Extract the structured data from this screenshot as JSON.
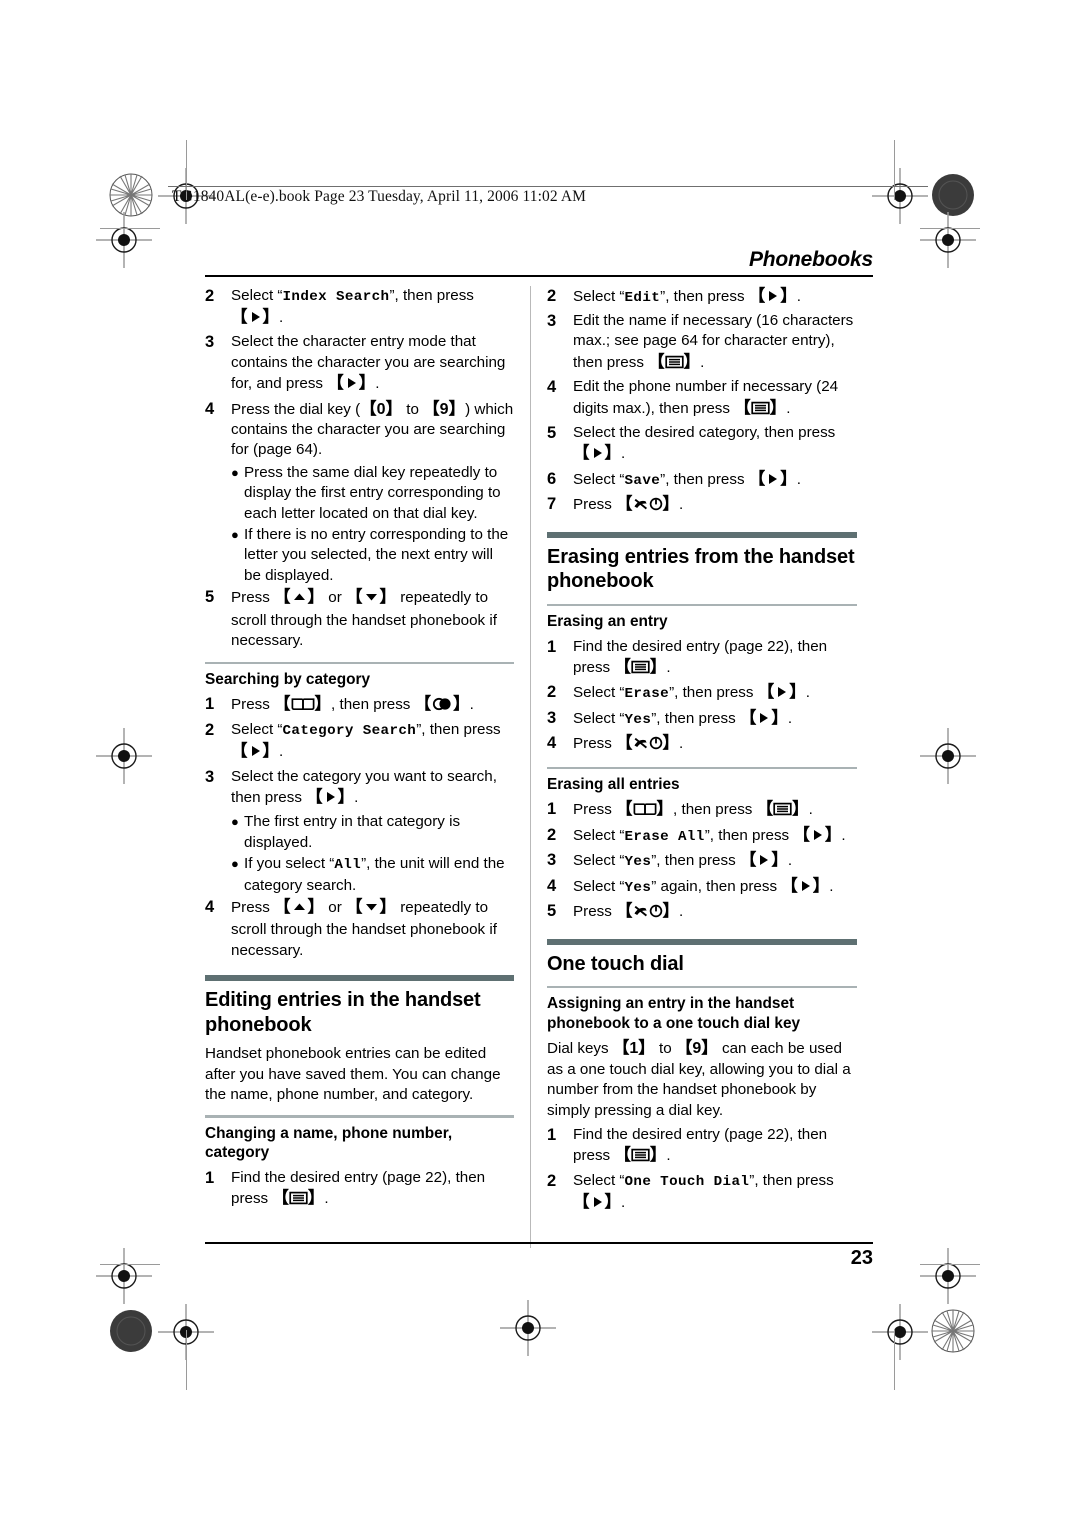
{
  "slug": "TG1840AL(e-e).book  Page 23  Tuesday, April 11, 2006  11:02 AM",
  "running_head": "Phonebooks",
  "page_number": "23",
  "colors": {
    "section_bar": "#5e7072",
    "subsection_rule": "#a9b2b4",
    "head_rule": "#000000"
  },
  "left_column": {
    "index_search_steps": [
      {
        "num": "2",
        "parts": [
          {
            "t": "text",
            "v": "Select “"
          },
          {
            "t": "mono",
            "v": "Index Search"
          },
          {
            "t": "text",
            "v": "”, then press "
          },
          {
            "t": "key",
            "icon": "right-arrow-key"
          },
          {
            "t": "text",
            "v": "."
          }
        ]
      },
      {
        "num": "3",
        "parts": [
          {
            "t": "text",
            "v": "Select the character entry mode that contains the character you are searching for, and press "
          },
          {
            "t": "key",
            "icon": "right-arrow-key"
          },
          {
            "t": "text",
            "v": "."
          }
        ]
      },
      {
        "num": "4",
        "parts": [
          {
            "t": "text",
            "v": "Press the dial key ("
          },
          {
            "t": "key",
            "icon": "digit-key",
            "label": "0"
          },
          {
            "t": "text",
            "v": " to "
          },
          {
            "t": "key",
            "icon": "digit-key",
            "label": "9"
          },
          {
            "t": "text",
            "v": ") which contains the character you are searching for (page 64)."
          }
        ]
      }
    ],
    "index_search_bullets": [
      "Press the same dial key repeatedly to display the first entry corresponding to each letter located on that dial key.",
      "If there is no entry corresponding to the letter you selected, the next entry will be displayed."
    ],
    "index_search_step5": {
      "num": "5",
      "parts": [
        {
          "t": "text",
          "v": "Press "
        },
        {
          "t": "key",
          "icon": "up-arrow-key"
        },
        {
          "t": "text",
          "v": " or "
        },
        {
          "t": "key",
          "icon": "down-arrow-key"
        },
        {
          "t": "text",
          "v": " repeatedly to scroll through the handset phonebook if necessary."
        }
      ]
    },
    "searching_by_category": {
      "heading": "Searching by category",
      "steps": [
        {
          "num": "1",
          "parts": [
            {
              "t": "text",
              "v": "Press "
            },
            {
              "t": "key",
              "icon": "phonebook-key"
            },
            {
              "t": "text",
              "v": ", then press "
            },
            {
              "t": "key",
              "icon": "talk-key"
            },
            {
              "t": "text",
              "v": "."
            }
          ]
        },
        {
          "num": "2",
          "parts": [
            {
              "t": "text",
              "v": "Select “"
            },
            {
              "t": "mono",
              "v": "Category Search"
            },
            {
              "t": "text",
              "v": "”, then press "
            },
            {
              "t": "key",
              "icon": "right-arrow-key"
            },
            {
              "t": "text",
              "v": "."
            }
          ]
        },
        {
          "num": "3",
          "parts": [
            {
              "t": "text",
              "v": "Select the category you want to search, then press "
            },
            {
              "t": "key",
              "icon": "right-arrow-key"
            },
            {
              "t": "text",
              "v": "."
            }
          ]
        }
      ],
      "bullets": [
        [
          {
            "t": "text",
            "v": "The first entry in that category is displayed."
          }
        ],
        [
          {
            "t": "text",
            "v": "If you select “"
          },
          {
            "t": "mono",
            "v": "All"
          },
          {
            "t": "text",
            "v": "”, the unit will end the category search."
          }
        ]
      ],
      "step4": {
        "num": "4",
        "parts": [
          {
            "t": "text",
            "v": "Press "
          },
          {
            "t": "key",
            "icon": "up-arrow-key"
          },
          {
            "t": "text",
            "v": " or "
          },
          {
            "t": "key",
            "icon": "down-arrow-key"
          },
          {
            "t": "text",
            "v": " repeatedly to scroll through the handset phonebook if necessary."
          }
        ]
      }
    },
    "editing_section": {
      "title": "Editing entries in the handset phonebook",
      "intro": "Handset phonebook entries can be edited after you have saved them. You can change the name, phone number, and category.",
      "sub_heading": "Changing a name, phone number, category",
      "step1": {
        "num": "1",
        "parts": [
          {
            "t": "text",
            "v": "Find the desired entry (page 22), then press "
          },
          {
            "t": "key",
            "icon": "menu-ok-key"
          },
          {
            "t": "text",
            "v": "."
          }
        ]
      }
    }
  },
  "right_column": {
    "editing_steps": [
      {
        "num": "2",
        "parts": [
          {
            "t": "text",
            "v": "Select “"
          },
          {
            "t": "mono",
            "v": "Edit"
          },
          {
            "t": "text",
            "v": "”, then press "
          },
          {
            "t": "key",
            "icon": "right-arrow-key"
          },
          {
            "t": "text",
            "v": "."
          }
        ]
      },
      {
        "num": "3",
        "parts": [
          {
            "t": "text",
            "v": "Edit the name if necessary (16 characters max.; see page 64 for character entry), then press "
          },
          {
            "t": "key",
            "icon": "menu-ok-key"
          },
          {
            "t": "text",
            "v": "."
          }
        ]
      },
      {
        "num": "4",
        "parts": [
          {
            "t": "text",
            "v": "Edit the phone number if necessary (24 digits max.), then press "
          },
          {
            "t": "key",
            "icon": "menu-ok-key"
          },
          {
            "t": "text",
            "v": "."
          }
        ]
      },
      {
        "num": "5",
        "parts": [
          {
            "t": "text",
            "v": "Select the desired category, then press "
          },
          {
            "t": "key",
            "icon": "right-arrow-key"
          },
          {
            "t": "text",
            "v": "."
          }
        ]
      },
      {
        "num": "6",
        "parts": [
          {
            "t": "text",
            "v": "Select “"
          },
          {
            "t": "mono",
            "v": "Save"
          },
          {
            "t": "text",
            "v": "”, then press "
          },
          {
            "t": "key",
            "icon": "right-arrow-key"
          },
          {
            "t": "text",
            "v": "."
          }
        ]
      },
      {
        "num": "7",
        "parts": [
          {
            "t": "text",
            "v": "Press "
          },
          {
            "t": "key",
            "icon": "off-power-key"
          },
          {
            "t": "text",
            "v": "."
          }
        ]
      }
    ],
    "erasing_section": {
      "title": "Erasing entries from the handset phonebook",
      "erasing_an_entry": {
        "heading": "Erasing an entry",
        "steps": [
          {
            "num": "1",
            "parts": [
              {
                "t": "text",
                "v": "Find the desired entry (page 22), then press "
              },
              {
                "t": "key",
                "icon": "menu-ok-key"
              },
              {
                "t": "text",
                "v": "."
              }
            ]
          },
          {
            "num": "2",
            "parts": [
              {
                "t": "text",
                "v": "Select “"
              },
              {
                "t": "mono",
                "v": "Erase"
              },
              {
                "t": "text",
                "v": "”, then press "
              },
              {
                "t": "key",
                "icon": "right-arrow-key"
              },
              {
                "t": "text",
                "v": "."
              }
            ]
          },
          {
            "num": "3",
            "parts": [
              {
                "t": "text",
                "v": "Select “"
              },
              {
                "t": "mono",
                "v": "Yes"
              },
              {
                "t": "text",
                "v": "”, then press "
              },
              {
                "t": "key",
                "icon": "right-arrow-key"
              },
              {
                "t": "text",
                "v": "."
              }
            ]
          },
          {
            "num": "4",
            "parts": [
              {
                "t": "text",
                "v": "Press "
              },
              {
                "t": "key",
                "icon": "off-power-key"
              },
              {
                "t": "text",
                "v": "."
              }
            ]
          }
        ]
      },
      "erasing_all_entries": {
        "heading": "Erasing all entries",
        "steps": [
          {
            "num": "1",
            "parts": [
              {
                "t": "text",
                "v": "Press "
              },
              {
                "t": "key",
                "icon": "phonebook-key"
              },
              {
                "t": "text",
                "v": ", then press "
              },
              {
                "t": "key",
                "icon": "menu-ok-key"
              },
              {
                "t": "text",
                "v": "."
              }
            ]
          },
          {
            "num": "2",
            "parts": [
              {
                "t": "text",
                "v": "Select “"
              },
              {
                "t": "mono",
                "v": "Erase All"
              },
              {
                "t": "text",
                "v": "”, then press "
              },
              {
                "t": "key",
                "icon": "right-arrow-key"
              },
              {
                "t": "text",
                "v": "."
              }
            ]
          },
          {
            "num": "3",
            "parts": [
              {
                "t": "text",
                "v": "Select “"
              },
              {
                "t": "mono",
                "v": "Yes"
              },
              {
                "t": "text",
                "v": "”, then press "
              },
              {
                "t": "key",
                "icon": "right-arrow-key"
              },
              {
                "t": "text",
                "v": "."
              }
            ]
          },
          {
            "num": "4",
            "parts": [
              {
                "t": "text",
                "v": "Select “"
              },
              {
                "t": "mono",
                "v": "Yes"
              },
              {
                "t": "text",
                "v": "” again, then press "
              },
              {
                "t": "key",
                "icon": "right-arrow-key"
              },
              {
                "t": "text",
                "v": "."
              }
            ]
          },
          {
            "num": "5",
            "parts": [
              {
                "t": "text",
                "v": "Press "
              },
              {
                "t": "key",
                "icon": "off-power-key"
              },
              {
                "t": "text",
                "v": "."
              }
            ]
          }
        ]
      }
    },
    "one_touch_dial": {
      "title": "One touch dial",
      "sub_heading": "Assigning an entry in the handset phonebook to a one touch dial key",
      "intro_parts": [
        {
          "t": "text",
          "v": "Dial keys "
        },
        {
          "t": "key",
          "icon": "digit-key",
          "label": "1"
        },
        {
          "t": "text",
          "v": " to "
        },
        {
          "t": "key",
          "icon": "digit-key",
          "label": "9"
        },
        {
          "t": "text",
          "v": " can each be used as a one touch dial key, allowing you to dial a number from the handset phonebook by simply pressing a dial key."
        }
      ],
      "steps": [
        {
          "num": "1",
          "parts": [
            {
              "t": "text",
              "v": "Find the desired entry (page 22), then press "
            },
            {
              "t": "key",
              "icon": "menu-ok-key"
            },
            {
              "t": "text",
              "v": "."
            }
          ]
        },
        {
          "num": "2",
          "parts": [
            {
              "t": "text",
              "v": "Select “"
            },
            {
              "t": "mono",
              "v": "One Touch Dial"
            },
            {
              "t": "text",
              "v": "”, then press "
            },
            {
              "t": "key",
              "icon": "right-arrow-key"
            },
            {
              "t": "text",
              "v": "."
            }
          ]
        }
      ]
    }
  }
}
